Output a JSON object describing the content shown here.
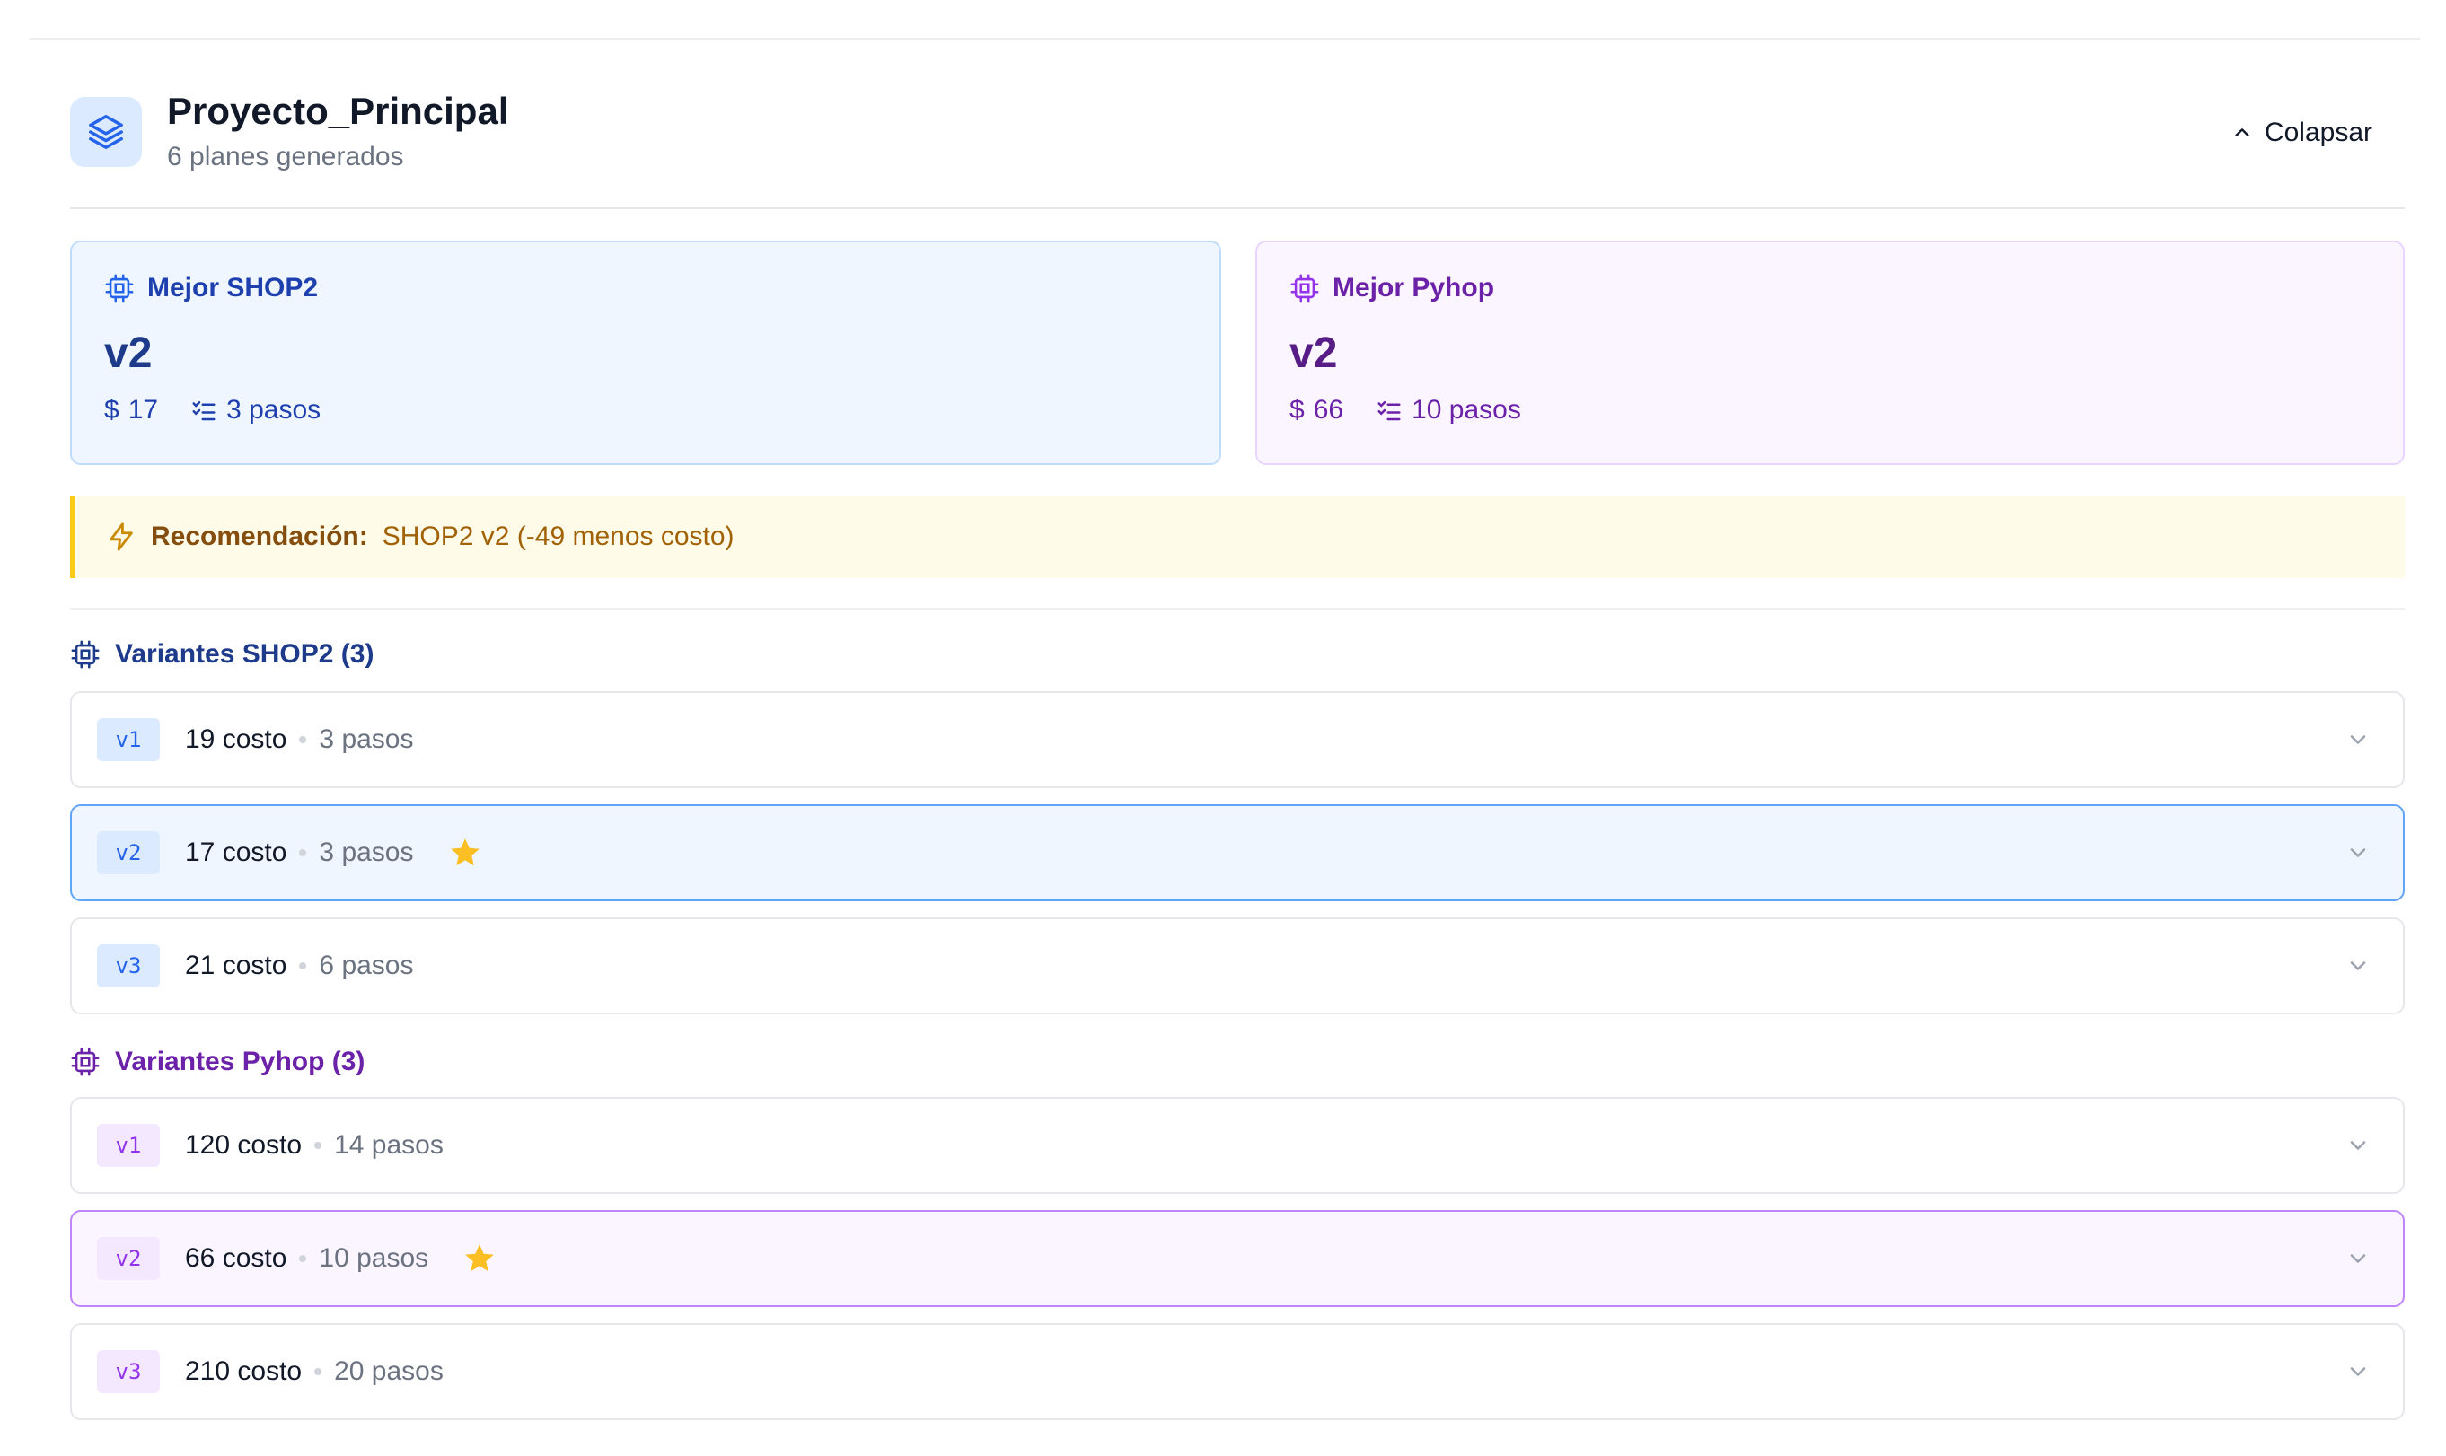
{
  "project": {
    "title": "Proyecto_Principal",
    "subtitle": "6 planes generados",
    "collapse_label": "Colapsar"
  },
  "best": {
    "shop2": {
      "title": "Mejor SHOP2",
      "version": "v2",
      "cost": "17",
      "steps": "3 pasos"
    },
    "pyhop": {
      "title": "Mejor Pyhop",
      "version": "v2",
      "cost": "66",
      "steps": "10 pasos"
    }
  },
  "recommendation": {
    "label": "Recomendación:",
    "value": "SHOP2 v2 (-49 menos costo)"
  },
  "sections": {
    "shop2": {
      "title": "Variantes SHOP2 (3)",
      "variants": [
        {
          "version": "v1",
          "cost": "19 costo",
          "steps": "3 pasos",
          "best": false
        },
        {
          "version": "v2",
          "cost": "17 costo",
          "steps": "3 pasos",
          "best": true
        },
        {
          "version": "v3",
          "cost": "21 costo",
          "steps": "6 pasos",
          "best": false
        }
      ]
    },
    "pyhop": {
      "title": "Variantes Pyhop (3)",
      "variants": [
        {
          "version": "v1",
          "cost": "120 costo",
          "steps": "14 pasos",
          "best": false
        },
        {
          "version": "v2",
          "cost": "66 costo",
          "steps": "10 pasos",
          "best": true
        },
        {
          "version": "v3",
          "cost": "210 costo",
          "steps": "20 pasos",
          "best": false
        }
      ]
    }
  },
  "icons": {
    "project": "layers-icon",
    "engine": "cpu-chip-icon",
    "cost": "dollar-icon",
    "steps": "list-checks-icon",
    "recommendation": "lightning-icon",
    "best": "star-icon",
    "expand": "chevron-down-icon",
    "collapse": "chevron-up-icon"
  },
  "colors": {
    "shop2_accent": "#2563eb",
    "pyhop_accent": "#9333ea",
    "recommendation_bg": "#fefce8",
    "recommendation_bar": "#facc15",
    "star": "#fbbf24"
  }
}
